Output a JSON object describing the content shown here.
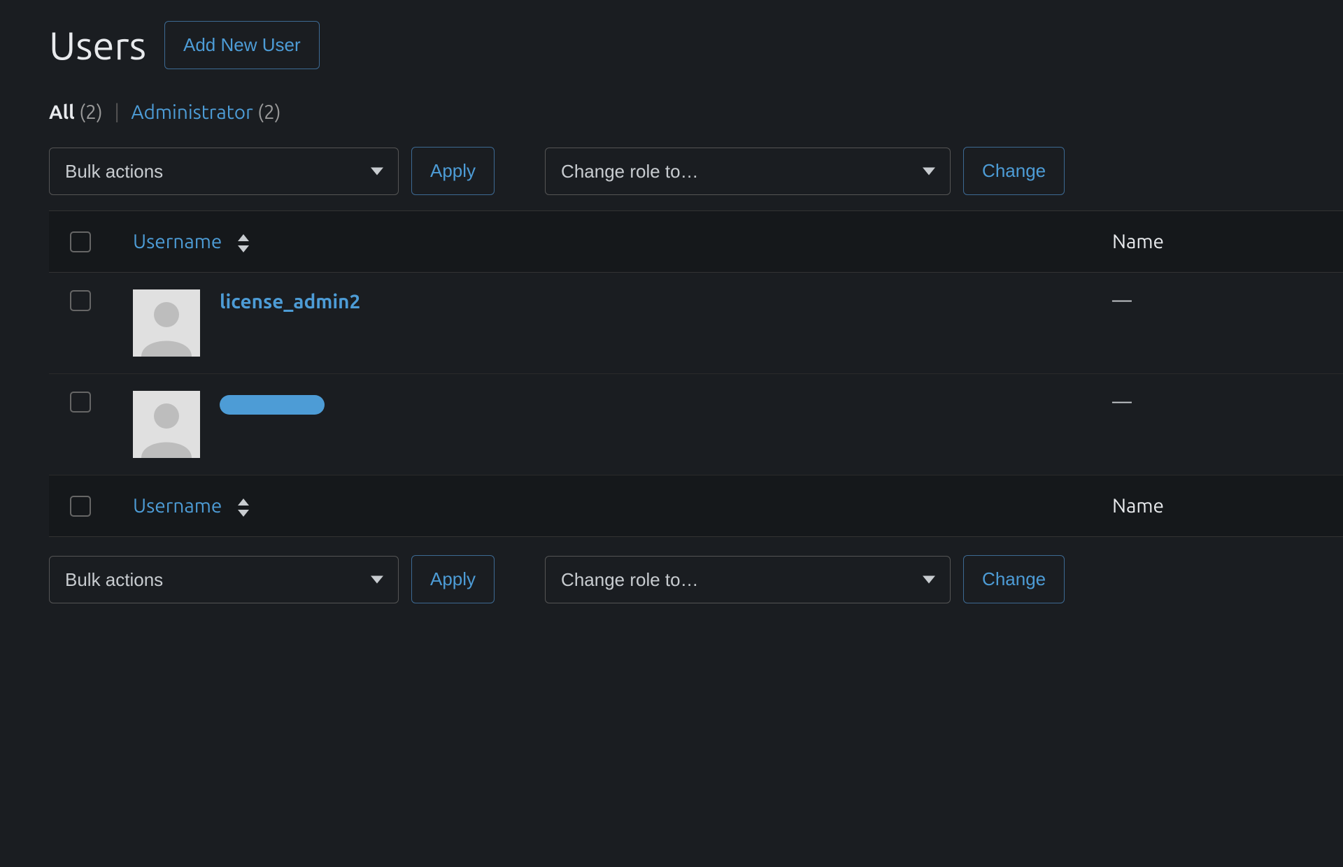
{
  "page": {
    "title": "Users",
    "addButton": "Add New User"
  },
  "filters": {
    "allLabel": "All",
    "allCount": "(2)",
    "adminLabel": "Administrator",
    "adminCount": "(2)"
  },
  "actions": {
    "bulkLabel": "Bulk actions",
    "applyLabel": "Apply",
    "roleLabel": "Change role to…",
    "changeLabel": "Change"
  },
  "table": {
    "colUsername": "Username",
    "colName": "Name",
    "rows": [
      {
        "username": "license_admin2",
        "name": "—",
        "redacted": false
      },
      {
        "username": "",
        "name": "—",
        "redacted": true
      }
    ]
  }
}
